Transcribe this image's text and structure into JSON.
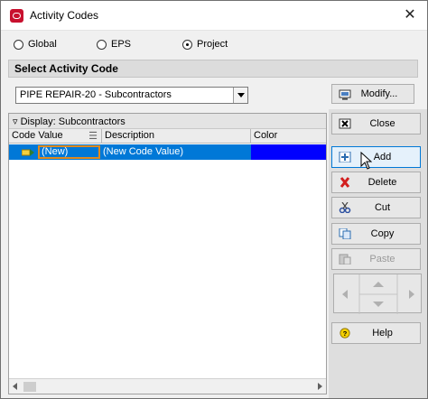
{
  "window": {
    "title": "Activity Codes"
  },
  "scope": {
    "options": [
      "Global",
      "EPS",
      "Project"
    ],
    "selected": "Project"
  },
  "section_title": "Select Activity Code",
  "code_select": {
    "value": "PIPE REPAIR-20 - Subcontractors"
  },
  "buttons": {
    "modify": "Modify...",
    "close": "Close",
    "add": "Add",
    "delete": "Delete",
    "cut": "Cut",
    "copy": "Copy",
    "paste": "Paste",
    "help": "Help"
  },
  "grid": {
    "display_label": "Display: Subcontractors",
    "columns": [
      "Code Value",
      "Description",
      "Color"
    ],
    "rows": [
      {
        "code_value": "(New)",
        "description": "(New Code Value)",
        "color": "#0000ff"
      }
    ]
  },
  "colors": {
    "selection": "#0078d7",
    "row_color_swatch": "#0000ff",
    "edit_border": "#e08a1e"
  },
  "icons": [
    "oracle-app-icon",
    "close-icon",
    "modify-icon",
    "close-window-icon",
    "add-icon",
    "delete-icon",
    "cut-icon",
    "copy-icon",
    "paste-icon",
    "move-left-icon",
    "move-up-icon",
    "move-down-icon",
    "move-right-icon",
    "help-icon"
  ]
}
